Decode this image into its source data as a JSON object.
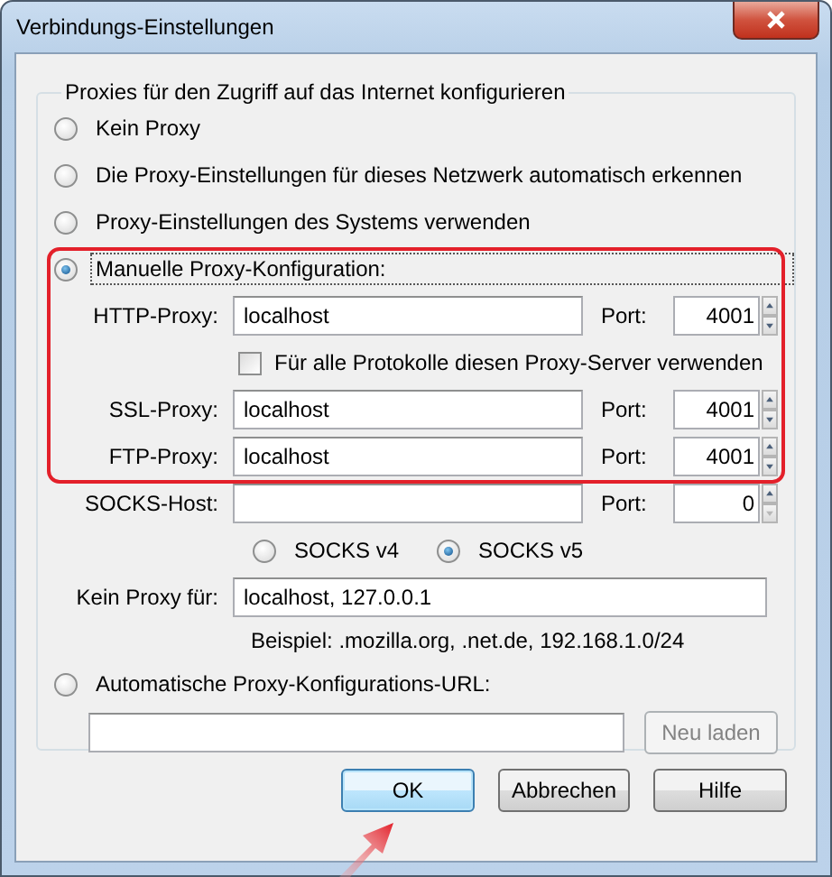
{
  "window": {
    "title": "Verbindungs-Einstellungen"
  },
  "group": {
    "legend": "Proxies für den Zugriff auf das Internet konfigurieren"
  },
  "modes": [
    {
      "kind": "plain",
      "label": "Kein Proxy",
      "selected": false,
      "focused": false
    },
    {
      "kind": "plain",
      "label": "Die Proxy-Einstellungen für dieses Netzwerk automatisch erkennen",
      "selected": false,
      "focused": false
    },
    {
      "kind": "plain",
      "label": "Proxy-Einstellungen des Systems verwenden",
      "selected": false,
      "focused": false
    },
    {
      "kind": "manual",
      "label": "Manuelle Proxy-Konfiguration:",
      "selected": true,
      "focused": true
    },
    {
      "kind": "pac",
      "label": "Automatische Proxy-Konfigurations-URL:",
      "selected": false,
      "focused": false
    }
  ],
  "proxies": [
    {
      "label": "HTTP-Proxy:",
      "host": "localhost",
      "port_label": "Port:",
      "port": "4001",
      "spin_down_disabled": false
    },
    {
      "label": "SSL-Proxy:",
      "host": "localhost",
      "port_label": "Port:",
      "port": "4001",
      "spin_down_disabled": false
    },
    {
      "label": "FTP-Proxy:",
      "host": "localhost",
      "port_label": "Port:",
      "port": "4001",
      "spin_down_disabled": false
    },
    {
      "label": "SOCKS-Host:",
      "port_label": "Port:",
      "port": "0",
      "spin_down_disabled": true
    }
  ],
  "share_all": {
    "label": "Für alle Protokolle diesen Proxy-Server verwenden",
    "checked": false
  },
  "socks_versions": [
    {
      "label": "SOCKS v4",
      "selected": false
    },
    {
      "label": "SOCKS v5",
      "selected": true
    }
  ],
  "no_proxy": {
    "label": "Kein Proxy für:",
    "value": "localhost, 127.0.0.1"
  },
  "example": "Beispiel: .mozilla.org, .net.de, 192.168.1.0/24",
  "reload_button": {
    "label": "Neu laden",
    "disabled": true
  },
  "buttons": [
    {
      "label": "OK",
      "default": true
    },
    {
      "label": "Abbrechen",
      "default": false
    },
    {
      "label": "Hilfe",
      "default": false
    }
  ]
}
